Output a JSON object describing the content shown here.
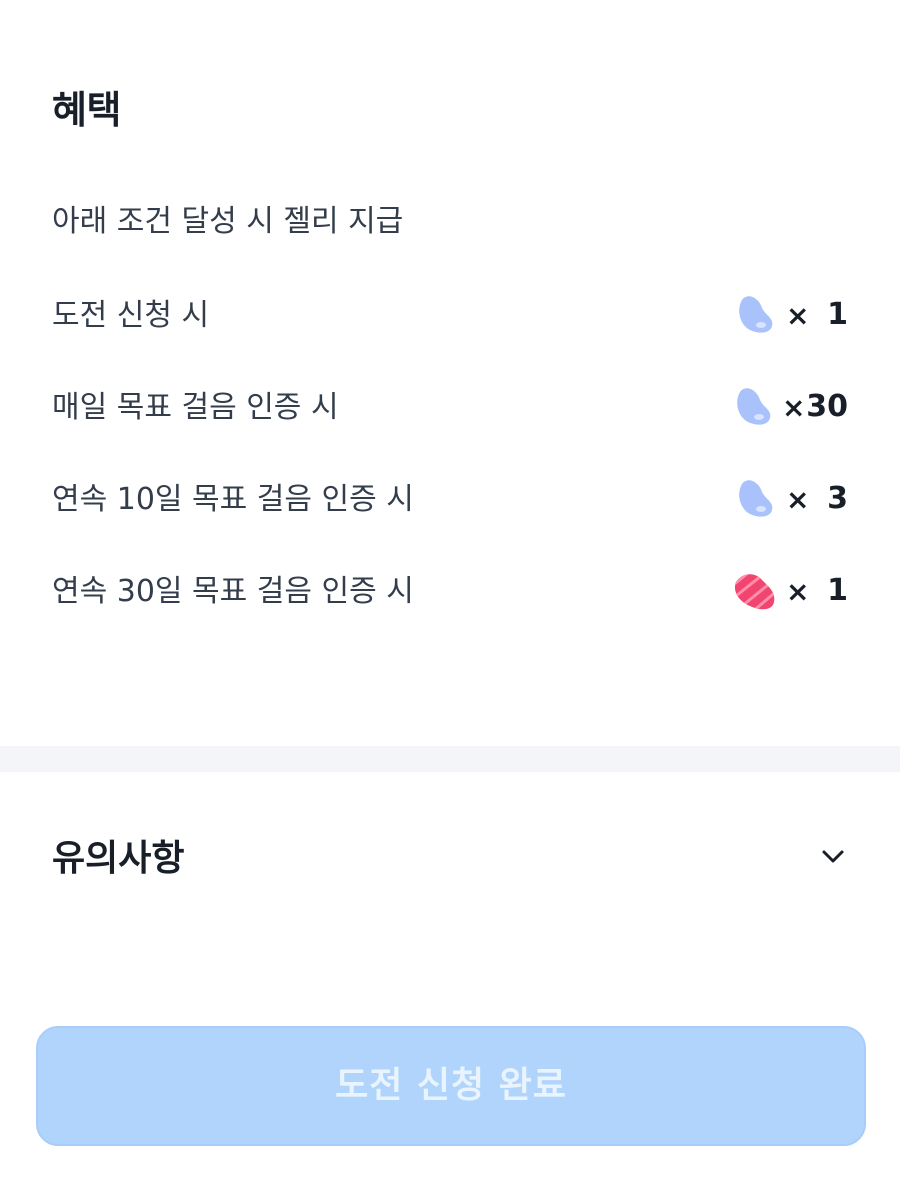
{
  "benefits": {
    "title": "혜택",
    "subtitle": "아래 조건 달성 시 젤리 지급",
    "rows": [
      {
        "label": "도전 신청 시",
        "jelly": "blue",
        "times": "×",
        "count": "1"
      },
      {
        "label": "매일 목표 걸음 인증 시",
        "jelly": "blue",
        "times": "×",
        "count": "30"
      },
      {
        "label": "연속 10일 목표 걸음 인증 시",
        "jelly": "blue",
        "times": "×",
        "count": "3"
      },
      {
        "label": "연속 30일 목표 걸음 인증 시",
        "jelly": "pink-striped",
        "times": "×",
        "count": "1"
      }
    ]
  },
  "notice": {
    "title": "유의사항",
    "icon": "chevron-down-icon"
  },
  "cta": {
    "label": "도전 신청 완료",
    "color": "#b0d4fb"
  },
  "colors": {
    "blue_jelly": "#a9c2fb",
    "pink_jelly": "#f1446e",
    "divider": "#f3f5f8"
  }
}
